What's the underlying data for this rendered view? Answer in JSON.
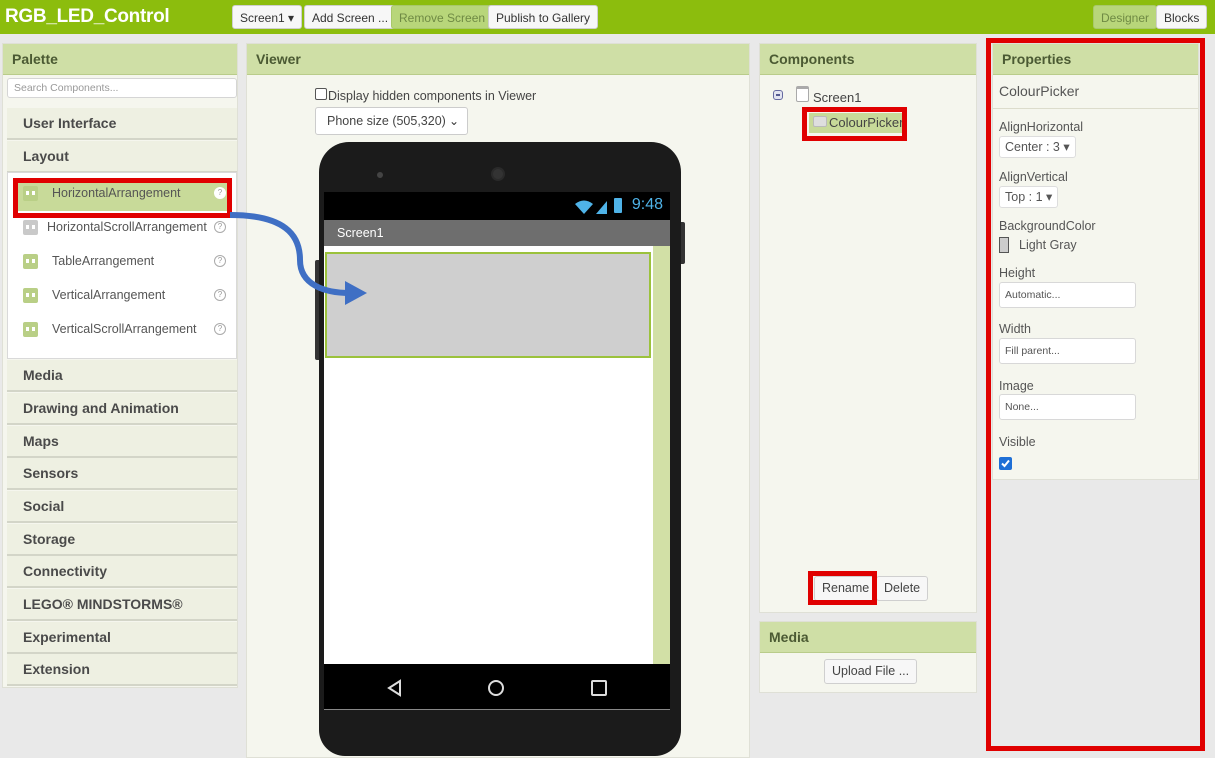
{
  "app": {
    "title": "RGB_LED_Control",
    "toolbar": {
      "screen_select": "Screen1 ▾",
      "add_screen": "Add Screen ...",
      "remove_screen": "Remove Screen",
      "publish": "Publish to Gallery",
      "designer": "Designer",
      "blocks": "Blocks"
    }
  },
  "palette": {
    "title": "Palette",
    "search_placeholder": "Search Components...",
    "categories_top": [
      "User Interface",
      "Layout"
    ],
    "layout_items": [
      {
        "label": "HorizontalArrangement",
        "icon": "horizontal-arrangement-icon",
        "selected": true
      },
      {
        "label": "HorizontalScrollArrangement",
        "icon": "horizontal-scroll-arrangement-icon"
      },
      {
        "label": "TableArrangement",
        "icon": "table-arrangement-icon"
      },
      {
        "label": "VerticalArrangement",
        "icon": "vertical-arrangement-icon"
      },
      {
        "label": "VerticalScrollArrangement",
        "icon": "vertical-scroll-arrangement-icon"
      }
    ],
    "help_glyph": "?",
    "categories_bottom": [
      "Media",
      "Drawing and Animation",
      "Maps",
      "Sensors",
      "Social",
      "Storage",
      "Connectivity",
      "LEGO® MINDSTORMS®",
      "Experimental",
      "Extension"
    ]
  },
  "viewer": {
    "title": "Viewer",
    "hidden_checkbox_label": "Display hidden components in Viewer",
    "hidden_checked": false,
    "phone_size": "Phone size (505,320)",
    "status_time": "9:48",
    "screen_title": "Screen1"
  },
  "components": {
    "title": "Components",
    "tree": [
      {
        "label": "Screen1",
        "children": [
          {
            "label": "ColourPicker",
            "selected": true
          }
        ]
      }
    ],
    "rename": "Rename",
    "delete": "Delete"
  },
  "media": {
    "title": "Media",
    "upload": "Upload File ..."
  },
  "properties": {
    "title": "Properties",
    "component": "ColourPicker",
    "align_horizontal": {
      "label": "AlignHorizontal",
      "value": "Center : 3 ▾"
    },
    "align_vertical": {
      "label": "AlignVertical",
      "value": "Top : 1 ▾"
    },
    "background_color": {
      "label": "BackgroundColor",
      "value": "Light Gray",
      "swatch": "#cccccc"
    },
    "height": {
      "label": "Height",
      "value": "Automatic..."
    },
    "width": {
      "label": "Width",
      "value": "Fill parent..."
    },
    "image": {
      "label": "Image",
      "value": "None..."
    },
    "visible": {
      "label": "Visible",
      "checked": true
    }
  },
  "annotations": {
    "highlight_color": "#e00000",
    "arrow_color": "#3f6fc4"
  }
}
